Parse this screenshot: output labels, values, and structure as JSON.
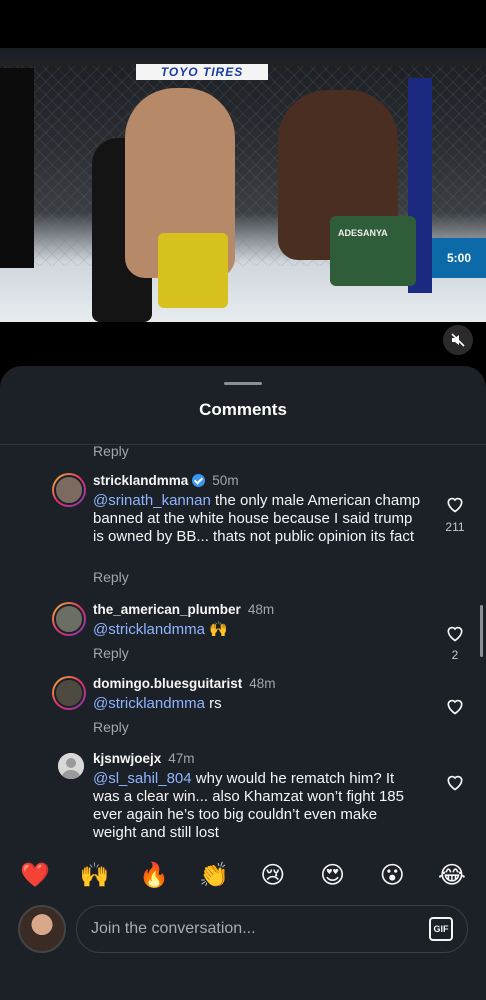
{
  "video": {
    "banner_text": "TOYO TIRES",
    "shorts_text": "ADESANYA",
    "sign_text": "5:00"
  },
  "sheet": {
    "title": "Comments"
  },
  "top_reply": "Reply",
  "comments": [
    {
      "username": "stricklandmma",
      "verified": true,
      "time": "50m",
      "mention": "@srinath_kannan",
      "text": " the only male American champ banned at the white house because I said trump is owned by BB... thats not public opinion its fact",
      "reply_label": "Reply",
      "likes": "211"
    },
    {
      "username": "the_american_plumber",
      "verified": false,
      "time": "48m",
      "mention": "@stricklandmma",
      "text": " 🙌",
      "reply_label": "Reply",
      "likes": "2"
    },
    {
      "username": "domingo.bluesguitarist",
      "verified": false,
      "time": "48m",
      "mention": "@stricklandmma",
      "text": " rs",
      "reply_label": "Reply",
      "likes": ""
    },
    {
      "username": "kjsnwjoejx",
      "verified": false,
      "time": "47m",
      "mention": "@sl_sahil_804",
      "text": " why would he rematch him? It was a clear win... also Khamzat won’t fight 185 ever again he’s too big couldn’t even make weight and still lost",
      "reply_label": "",
      "likes": ""
    }
  ],
  "emoji_bar": [
    "❤️",
    "🙌",
    "🔥",
    "👏",
    "😢",
    "😍",
    "😮",
    "😂"
  ],
  "composer": {
    "placeholder": "Join the conversation...",
    "gif_label": "GIF"
  },
  "icons": {
    "mute": "speaker-muted-icon",
    "heart": "heart-outline-icon",
    "verified": "verified-badge-icon"
  },
  "colors": {
    "sheet_bg": "#1c2128",
    "mention": "#8fb4ff",
    "verified": "#3897f0"
  }
}
